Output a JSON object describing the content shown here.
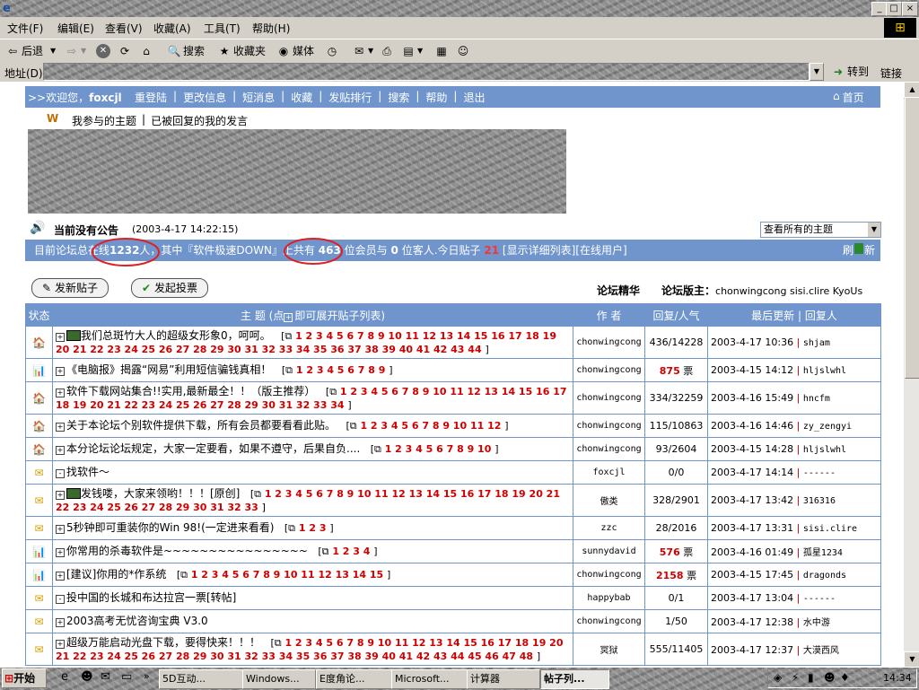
{
  "window": {
    "title": "",
    "buttons": {
      "minimize": "_",
      "maximize": "□",
      "close": "×"
    }
  },
  "menu": [
    "文件(F)",
    "编辑(E)",
    "查看(V)",
    "收藏(A)",
    "工具(T)",
    "帮助(H)"
  ],
  "toolbar": {
    "back": "后退",
    "search": "搜索",
    "favorites": "收藏夹",
    "media": "媒体"
  },
  "address": {
    "label": "地址(D)",
    "value": "",
    "go": "转到",
    "links": "链接"
  },
  "nav": {
    "welcome": ">>欢迎您，",
    "user": "foxcjl",
    "links": [
      "重登陆",
      "更改信息",
      "短消息",
      "收藏",
      "发贴排行",
      "搜索",
      "帮助",
      "退出"
    ],
    "home": "首页"
  },
  "subnav": {
    "my_topics": "我参与的主题",
    "replied": "已被回复的我的发言"
  },
  "announce": {
    "title": "当前没有公告",
    "time": "(2003-4-17 14:22:15)"
  },
  "view_select": {
    "value": "查看所有的主题"
  },
  "stats": {
    "prefix": "目前论坛总在线",
    "online": "1232",
    "unit1": "人，其中『软件极速DOWN』上共有",
    "members": "463",
    "unit2": "位会员与",
    "guests": "0",
    "unit3": "位客人.今日贴子",
    "today": "21",
    "detail": "[显示详细列表]",
    "online_users": "[在线用户]",
    "refresh": "刷",
    "refresh2": "新"
  },
  "buttons": {
    "new_post": "发新贴子",
    "new_poll": "发起投票"
  },
  "board": {
    "essence": "论坛精华",
    "admins_label": "论坛版主：",
    "admins": "chonwingcong sisi.clire KyoUs"
  },
  "table": {
    "headers": {
      "status": "状态",
      "topic": "主 题 (点",
      "topic2": "即可展开贴子列表)",
      "author": "作 者",
      "replies": "回复/人气",
      "last": "最后更新 | 回复人"
    },
    "rows": [
      {
        "icon": "🏠",
        "hot": true,
        "expand": "+",
        "title": "我们总斑竹大人的超级女形象0，呵呵。",
        "pages": "1 2 3 4 5 6 7 8 9 10 11 12 13 14 15 16 17 18 19 20 21 22 23 24 25 26 27 28 29 30 31 32 33 34 35 36 37 38 39 40 41 42 43 44",
        "author": "chonwingcong",
        "replies": "436/14228",
        "time": "2003-4-17 10:36",
        "replier": "shjam"
      },
      {
        "icon": "📊",
        "hot": false,
        "expand": "+",
        "title": "《电脑报》揭露“网易”利用短信骗钱真相！",
        "pages": "1 2 3 4 5 6 7 8 9",
        "author": "chonwingcong",
        "replies": "875",
        "replies_suffix": "票",
        "time": "2003-4-15 14:12",
        "replier": "hljslwhl"
      },
      {
        "icon": "🏠",
        "hot": false,
        "expand": "+",
        "title": "软件下载网站集合!!实用,最新最全！！（版主推荐）",
        "pages": "1 2 3 4 5 6 7 8 9 10 11 12 13 14 15 16 17 18 19 20 21 22 23 24 25 26 27 28 29 30 31 32 33 34",
        "author": "chonwingcong",
        "replies": "334/32259",
        "time": "2003-4-16 15:49",
        "replier": "hncfm"
      },
      {
        "icon": "🏠",
        "hot": false,
        "expand": "+",
        "title": "关于本论坛个别软件提供下载，所有会员都要看看此贴。",
        "pages": "1 2 3 4 5 6 7 8 9 10 11 12",
        "author": "chonwingcong",
        "replies": "115/10863",
        "time": "2003-4-16 14:46",
        "replier": "zy_zengyi"
      },
      {
        "icon": "🏠",
        "hot": false,
        "expand": "+",
        "title": "本分论坛论坛规定，大家一定要看，如果不遵守，后果自负....",
        "pages": "1 2 3 4 5 6 7 8 9 10",
        "author": "chonwingcong",
        "replies": "93/2604",
        "time": "2003-4-15 14:28",
        "replier": "hljslwhl"
      },
      {
        "icon": "✉",
        "hot": false,
        "expand": "-",
        "title": "找软件～",
        "pages": "",
        "author": "foxcjl",
        "replies": "0/0",
        "time": "2003-4-17 14:14",
        "replier": "------"
      },
      {
        "icon": "✉",
        "hot": true,
        "expand": "+",
        "title": "发钱喽，大家来领哟！！！[原创]",
        "pages": "1 2 3 4 5 6 7 8 9 10 11 12 13 14 15 16 17 18 19 20 21 22 23 24 25 26 27 28 29 30 31 32 33",
        "author": "傲类",
        "replies": "328/2901",
        "time": "2003-4-17 13:42",
        "replier": "316316"
      },
      {
        "icon": "✉",
        "hot": false,
        "expand": "+",
        "title": "5秒钟即可重装你的Win 98!(一定进来看看)",
        "pages": "1 2 3",
        "author": "zzc",
        "replies": "28/2016",
        "time": "2003-4-17 13:31",
        "replier": "sisi.clire"
      },
      {
        "icon": "📊",
        "hot": false,
        "expand": "+",
        "title": "你常用的杀毒软件是~~~~~~~~~~~~~~~~",
        "pages": "1 2 3 4",
        "author": "sunnydavid",
        "replies": "576",
        "replies_suffix": "票",
        "time": "2003-4-16 01:49",
        "replier": "孤星1234"
      },
      {
        "icon": "📊",
        "hot": false,
        "expand": "+",
        "title": "[建议]你用的*作系统",
        "pages": "1 2 3 4 5 6 7 8 9 10 11 12 13 14 15",
        "author": "chonwingcong",
        "replies": "2158",
        "replies_suffix": "票",
        "time": "2003-4-15 17:45",
        "replier": "dragonds"
      },
      {
        "icon": "✉",
        "hot": false,
        "expand": "-",
        "title": "投中国的长城和布达拉宫一票[转帖]",
        "pages": "",
        "author": "happybab",
        "replies": "0/1",
        "time": "2003-4-17 13:04",
        "replier": "------"
      },
      {
        "icon": "✉",
        "hot": false,
        "expand": "+",
        "title": "2003高考无忧咨询宝典 V3.0",
        "pages": "",
        "author": "chonwingcong",
        "replies": "1/50",
        "time": "2003-4-17 12:38",
        "replier": "水中游"
      },
      {
        "icon": "✉",
        "hot": false,
        "expand": "+",
        "title": "超级万能启动光盘下载，要得快来！！！",
        "pages": "1 2 3 4 5 6 7 8 9 10 11 12 13 14 15 16 17 18 19 20 21 22 23 24 25 26 27 28 29 30 31 32 33 34 35 36 37 38 39 40 41 42 43 44 45 46 47 48",
        "author": "冥狱",
        "replies": "555/11405",
        "time": "2003-4-17 12:37",
        "replier": "大漠西风"
      }
    ]
  },
  "taskbar": {
    "start": "开始",
    "tasks": [
      "5D互动...",
      "Windows...",
      "E度角论...",
      "Microsoft...",
      "计算器",
      "帖子列..."
    ],
    "clock": "14:34"
  }
}
